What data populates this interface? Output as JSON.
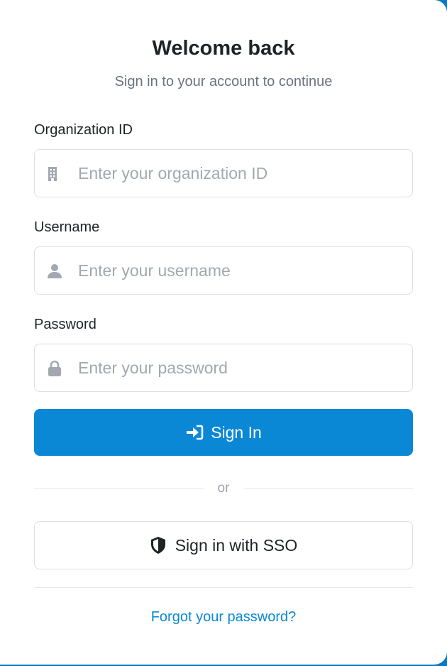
{
  "header": {
    "title": "Welcome back",
    "subtitle": "Sign in to your account to continue"
  },
  "form": {
    "organization": {
      "label": "Organization ID",
      "placeholder": "Enter your organization ID",
      "value": "",
      "icon": "building-icon"
    },
    "username": {
      "label": "Username",
      "placeholder": "Enter your username",
      "value": "",
      "icon": "user-icon"
    },
    "password": {
      "label": "Password",
      "placeholder": "Enter your password",
      "value": "",
      "icon": "lock-icon"
    },
    "submit": {
      "label": "Sign In",
      "icon": "sign-in-icon"
    }
  },
  "divider": {
    "text": "or"
  },
  "sso": {
    "label": "Sign in with SSO",
    "icon": "shield-icon"
  },
  "links": {
    "forgot_password": "Forgot your password?"
  },
  "colors": {
    "primary": "#0a88d6",
    "frame": "#0a7ac4",
    "text": "#1f2328",
    "muted": "#6b7280",
    "icon": "#a3a8b0"
  }
}
